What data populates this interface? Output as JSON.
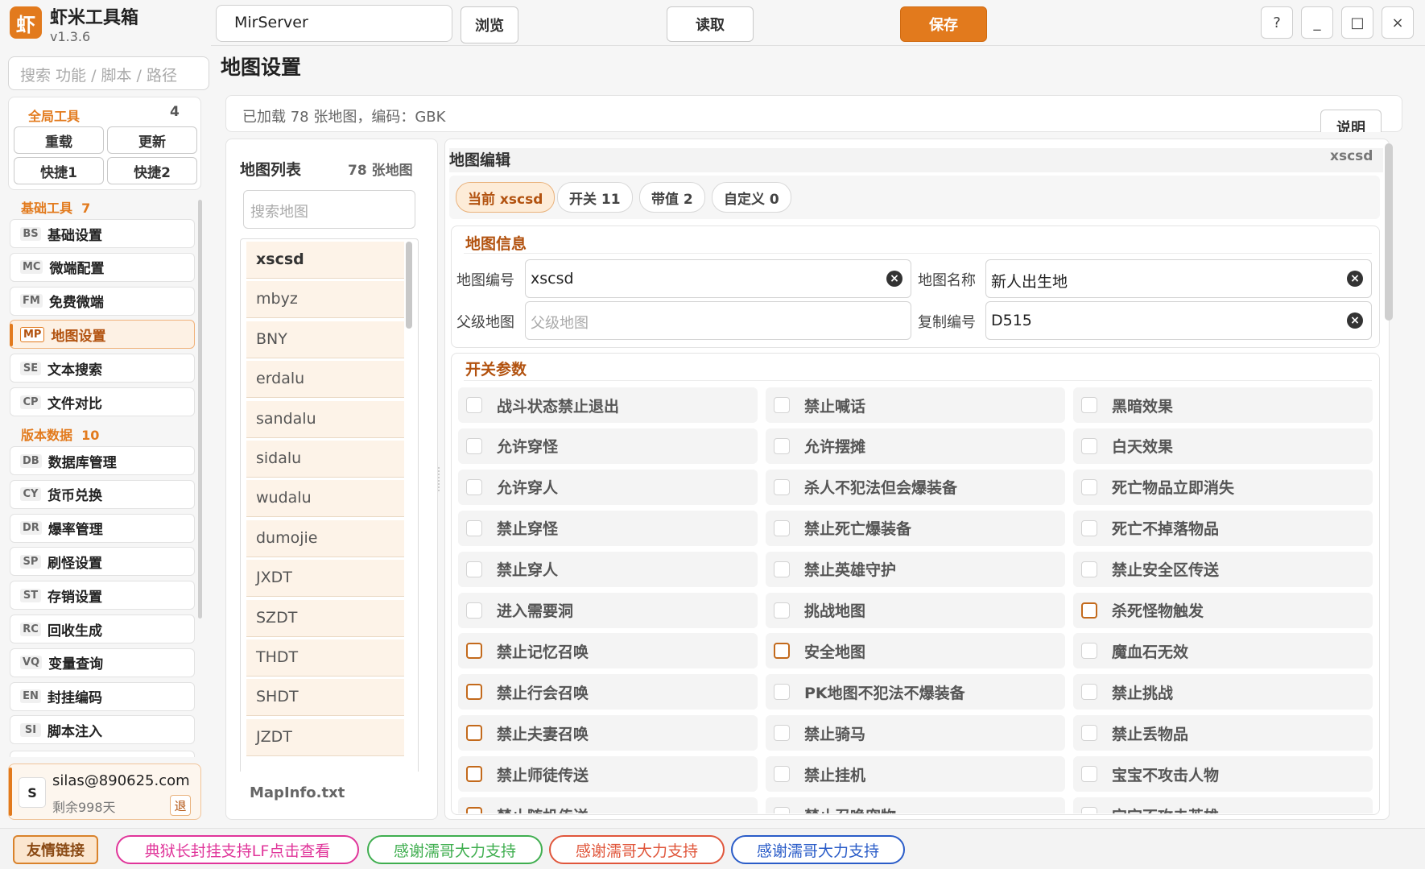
{
  "app": {
    "name": "虾米工具箱",
    "version": "v1.3.6",
    "logo_char": "虾"
  },
  "topbar": {
    "path_value": "MirServer",
    "browse": "浏览",
    "read": "读取",
    "save": "保存",
    "help": "?",
    "minimize": "_",
    "maximize": "□",
    "close": "×"
  },
  "left": {
    "search_placeholder": "搜索 功能 / 脚本 / 路径",
    "global": {
      "title": "全局工具",
      "count": "4",
      "buttons": [
        "重载",
        "更新",
        "快捷1",
        "快捷2"
      ]
    },
    "basic": {
      "title": "基础工具",
      "count": "7"
    },
    "basic_items": [
      {
        "code": "BS",
        "label": "基础设置"
      },
      {
        "code": "MC",
        "label": "微端配置"
      },
      {
        "code": "FM",
        "label": "免费微端"
      },
      {
        "code": "MP",
        "label": "地图设置"
      },
      {
        "code": "SE",
        "label": "文本搜索"
      },
      {
        "code": "CP",
        "label": "文件对比"
      }
    ],
    "version": {
      "title": "版本数据",
      "count": "10"
    },
    "version_items": [
      {
        "code": "DB",
        "label": "数据库管理"
      },
      {
        "code": "CY",
        "label": "货币兑换"
      },
      {
        "code": "DR",
        "label": "爆率管理"
      },
      {
        "code": "SP",
        "label": "刷怪设置"
      },
      {
        "code": "ST",
        "label": "存销设置"
      },
      {
        "code": "RC",
        "label": "回收生成"
      },
      {
        "code": "VQ",
        "label": "变量查询"
      },
      {
        "code": "EN",
        "label": "封挂编码"
      },
      {
        "code": "SI",
        "label": "脚本注入"
      }
    ],
    "user": {
      "avatar": "S",
      "email": "silas@890625.com",
      "remain": "剩余998天",
      "logout": "退"
    }
  },
  "page": {
    "title": "地图设置",
    "status": "已加载 78 张地图，编码：GBK",
    "explain": "说明"
  },
  "map_list": {
    "title": "地图列表",
    "count": "78 张地图",
    "search_placeholder": "搜索地图",
    "items": [
      "xscsd",
      "mbyz",
      "BNY",
      "erdalu",
      "sandalu",
      "sidalu",
      "wudalu",
      "dumojie",
      "JXDT",
      "SZDT",
      "THDT",
      "SHDT",
      "JZDT"
    ],
    "file": "MapInfo.txt"
  },
  "editor": {
    "title": "地图编辑",
    "current": "xscsd",
    "tabs": [
      {
        "label": "当前 xscsd",
        "active": true
      },
      {
        "label": "开关 11",
        "active": false
      },
      {
        "label": "带值 2",
        "active": false
      },
      {
        "label": "自定义 0",
        "active": false
      }
    ],
    "info_title": "地图信息",
    "fields": {
      "map_id_label": "地图编号",
      "map_id_value": "xscsd",
      "map_name_label": "地图名称",
      "map_name_value": "新人出生地",
      "parent_label": "父级地图",
      "parent_placeholder": "父级地图",
      "copy_label": "复制编号",
      "copy_value": "D515"
    },
    "switch_title": "开关参数",
    "switches": [
      {
        "label": "战斗状态禁止退出",
        "on": false
      },
      {
        "label": "禁止喊话",
        "on": false
      },
      {
        "label": "黑暗效果",
        "on": false
      },
      {
        "label": "允许穿怪",
        "on": false
      },
      {
        "label": "允许摆摊",
        "on": false
      },
      {
        "label": "白天效果",
        "on": false
      },
      {
        "label": "允许穿人",
        "on": false
      },
      {
        "label": "杀人不犯法但会爆装备",
        "on": false
      },
      {
        "label": "死亡物品立即消失",
        "on": false
      },
      {
        "label": "禁止穿怪",
        "on": false
      },
      {
        "label": "禁止死亡爆装备",
        "on": false
      },
      {
        "label": "死亡不掉落物品",
        "on": false
      },
      {
        "label": "禁止穿人",
        "on": false
      },
      {
        "label": "禁止英雄守护",
        "on": false
      },
      {
        "label": "禁止安全区传送",
        "on": false
      },
      {
        "label": "进入需要洞",
        "on": false
      },
      {
        "label": "挑战地图",
        "on": false
      },
      {
        "label": "杀死怪物触发",
        "on": true
      },
      {
        "label": "禁止记忆召唤",
        "on": true
      },
      {
        "label": "安全地图",
        "on": true
      },
      {
        "label": "魔血石无效",
        "on": false
      },
      {
        "label": "禁止行会召唤",
        "on": true
      },
      {
        "label": "PK地图不犯法不爆装备",
        "on": false
      },
      {
        "label": "禁止挑战",
        "on": false
      },
      {
        "label": "禁止夫妻召唤",
        "on": true
      },
      {
        "label": "禁止骑马",
        "on": false
      },
      {
        "label": "禁止丢物品",
        "on": false
      },
      {
        "label": "禁止师徒传送",
        "on": true
      },
      {
        "label": "禁止挂机",
        "on": false
      },
      {
        "label": "宝宝不攻击人物",
        "on": false
      },
      {
        "label": "禁止随机传送",
        "on": true
      },
      {
        "label": "禁止召唤宠物",
        "on": false
      },
      {
        "label": "宝宝不攻击英雄",
        "on": false
      }
    ]
  },
  "footer": [
    {
      "label": "友情链接",
      "color": "#d9822b"
    },
    {
      "label": "典狱长封挂支持LF点击查看",
      "color": "#e0359a"
    },
    {
      "label": "感谢濡哥大力支持",
      "color": "#3fae4f"
    },
    {
      "label": "感谢濡哥大力支持",
      "color": "#e0563b"
    },
    {
      "label": "感谢濡哥大力支持",
      "color": "#2a5cc8"
    }
  ],
  "colors": {
    "accent": "#e27a1d",
    "accent_light": "#fdf1e4"
  }
}
